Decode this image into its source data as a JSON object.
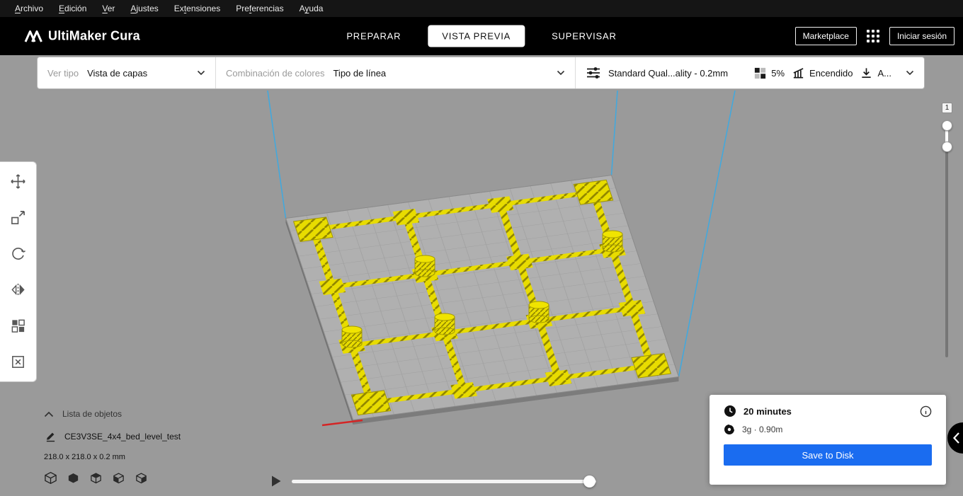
{
  "menubar": {
    "items": [
      {
        "label": "Archivo",
        "accel_index": 0
      },
      {
        "label": "Edición",
        "accel_index": 0
      },
      {
        "label": "Ver",
        "accel_index": 0
      },
      {
        "label": "Ajustes",
        "accel_index": 0
      },
      {
        "label": "Extensiones",
        "accel_index": 2
      },
      {
        "label": "Preferencias",
        "accel_index": 3
      },
      {
        "label": "Ayuda",
        "accel_index": 1
      }
    ]
  },
  "header": {
    "app_name": "UltiMaker Cura",
    "tabs": [
      {
        "label": "PREPARAR",
        "active": false
      },
      {
        "label": "VISTA PREVIA",
        "active": true
      },
      {
        "label": "SUPERVISAR",
        "active": false
      }
    ],
    "marketplace_label": "Marketplace",
    "sign_in_label": "Iniciar sesión"
  },
  "view_toolbar": {
    "view_type_label": "Ver tipo",
    "view_type_value": "Vista de capas",
    "color_scheme_label": "Combinación de colores",
    "color_scheme_value": "Tipo de línea"
  },
  "print_settings_bar": {
    "profile": "Standard Qual...ality - 0.2mm",
    "infill_value": "5%",
    "support_value": "Encendido",
    "adhesion_value": "A..."
  },
  "tool_panel": {
    "tools": [
      "move",
      "scale",
      "rotate",
      "mirror",
      "per-model-settings",
      "support-blocker"
    ]
  },
  "object_list": {
    "title": "Lista de objetos",
    "object_name": "CE3V3SE_4x4_bed_level_test",
    "dimensions": "218.0 x 218.0 x 0.2 mm"
  },
  "layer_slider": {
    "current_layer": "1"
  },
  "summary": {
    "print_time": "20 minutes",
    "material_usage": "3g · 0.90m",
    "save_button_label": "Save to Disk"
  },
  "icons": {
    "logo-mark-icon": "double-peak",
    "apps-grid-icon": "3x3-dots",
    "chevron-down-icon": "v",
    "sliders-icon": "three-sliders",
    "infill-icon": "checker-square",
    "support-icon": "overhang-pillars",
    "adhesion-icon": "arrow-to-plate",
    "move-tool-icon": "cross-arrows",
    "scale-tool-icon": "square-diagonal-arrow",
    "rotate-tool-icon": "circular-arrow",
    "mirror-tool-icon": "facing-triangles",
    "per-model-settings-icon": "four-blocks",
    "support-blocker-icon": "crossed-cube",
    "chevron-up-icon": "^",
    "rename-pencil-icon": "pencil",
    "camera-view-icons": "cubes",
    "play-icon": "triangle",
    "clock-icon": "clock",
    "material-spool-icon": "spool",
    "info-icon": "i-circle",
    "chevron-left-icon": "<"
  },
  "colors": {
    "accent_blue": "#1a6cf0",
    "preview_yellow": "#e8dc00",
    "build_volume_blue": "#3fa9e0",
    "viewport_gray": "#9a9a9a",
    "header_black": "#000000"
  }
}
